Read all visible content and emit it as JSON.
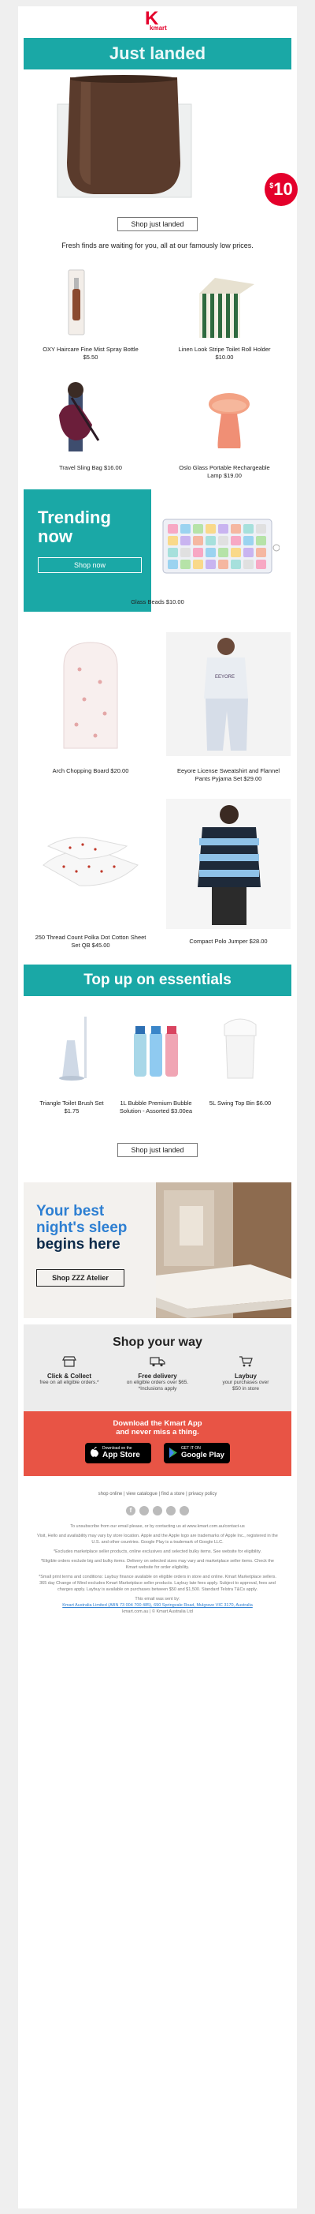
{
  "colors": {
    "teal": "#1aa8a6",
    "red": "#e4002b",
    "navy": "#0b2a4a",
    "blue": "#2d7fd2",
    "grey": "#efefef"
  },
  "logo": {
    "letter": "K",
    "word": "kmart"
  },
  "hero": {
    "banner": "Just landed",
    "price_symbol": "$",
    "price": "10",
    "button": "Shop just landed",
    "intro": "Fresh finds are waiting for you, all at our famously low prices."
  },
  "products_row1": [
    {
      "name": "OXY Haircare Fine Mist Spray Bottle",
      "price": "$5.50"
    },
    {
      "name": "Linen Look Stripe Toilet Roll Holder",
      "price": "$10.00"
    }
  ],
  "products_row2": [
    {
      "name": "Travel Sling Bag $16.00"
    },
    {
      "name": "Oslo Glass Portable Rechargeable Lamp $19.00"
    }
  ],
  "trending": {
    "title_line1": "Trending",
    "title_line2": "now",
    "button": "Shop now",
    "product": "Glass Beads $10.00"
  },
  "products_row3": [
    {
      "name": "Arch Chopping Board $20.00"
    },
    {
      "name": "Eeyore License Sweatshirt and Flannel Pants Pyjama Set $29.00"
    }
  ],
  "products_row4": [
    {
      "name": "250 Thread Count Polka Dot Cotton Sheet Set QB $45.00"
    },
    {
      "name": "Compact Polo Jumper $28.00"
    }
  ],
  "essentials": {
    "banner": "Top up on essentials",
    "items": [
      {
        "name": "Triangle Toilet Brush Set $1.75"
      },
      {
        "name": "1L Bubble Premium Bubble Solution - Assorted $3.00ea"
      },
      {
        "name": "5L Swing Top Bin $6.00"
      }
    ],
    "button": "Shop just landed"
  },
  "sleep": {
    "line1": "Your best",
    "line2": "night's sleep",
    "line3": "begins here",
    "button": "Shop ZZZ Atelier"
  },
  "shop_way": {
    "title": "Shop your way",
    "items": [
      {
        "icon": "store-icon",
        "title": "Click & Collect",
        "desc": "free on all eligible orders.*"
      },
      {
        "icon": "truck-icon",
        "title": "Free delivery",
        "desc": "on eligible orders over $65. *Inclusions apply"
      },
      {
        "icon": "cart-icon",
        "title": "Laybuy",
        "desc": "your purchases over $50 in store"
      }
    ]
  },
  "app": {
    "line1": "Download the Kmart App",
    "line2": "and never miss a thing.",
    "apple_small": "Download on the",
    "apple": "App Store",
    "google_small": "GET IT ON",
    "google": "Google Play"
  },
  "footer": {
    "links": [
      "shop online",
      "view catalogue",
      "find a store",
      "privacy policy"
    ],
    "line1": "To unsubscribe from our email please, or by contacting us at www.kmart.com.au/contact-us",
    "line2": "Visit, Hello and availability may vary by store location. Apple and the Apple logo are trademarks of Apple Inc., registered in the U.S. and other countries. Google Play is a trademark of Google LLC.",
    "line3": "*Excludes marketplace seller products, online exclusives and selected bulky items. See website for eligibility.",
    "line4": "*Eligible orders exclude big and bulky items. Delivery on selected sizes may vary and marketplace seller items. Check the Kmart website for order eligibility.",
    "line5": "*Small print terms and conditions: Laybuy finance available on eligible orders in store and online. Kmart Marketplace sellers. 365 day Change of Mind excludes Kmart Marketplace seller products. Laybuy late fees apply. Subject to approval, fees and charges apply. Laybuy is available on purchases between $50 and $1,500. Standard Telstra T&Cs apply.",
    "line6": "This email was sent by:",
    "line7": "Kmart Australia Limited (ABN 73 004 700 485), 690 Springvale Road, Mulgrave VIC 3170, Australia",
    "line8": "kmart.com.au | © Kmart Australia Ltd"
  }
}
